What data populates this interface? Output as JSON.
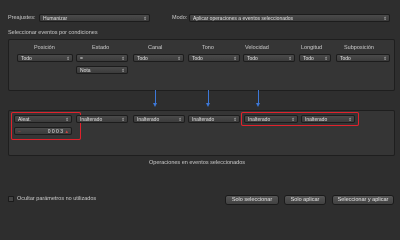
{
  "header": {
    "preset_label": "Preajustes:",
    "preset_value": "Humanizar",
    "mode_label": "Modo:",
    "mode_value": "Aplicar operaciones a eventos seleccionados"
  },
  "conditions": {
    "title": "Seleccionar eventos por condiciones",
    "columns": [
      {
        "label": "Posición",
        "value": "Todo"
      },
      {
        "label": "Estado",
        "value": "="
      },
      {
        "label": "Canal",
        "value": "Todo"
      },
      {
        "label": "Tono",
        "value": "Todo"
      },
      {
        "label": "Velocidad",
        "value": "Todo"
      },
      {
        "label": "Longitud",
        "value": "Todo"
      },
      {
        "label": "Subposición",
        "value": "Todo"
      }
    ],
    "estado_sub": "Nota"
  },
  "operations": {
    "items": [
      {
        "value": "Aleat."
      },
      {
        "value": "Inalterado"
      },
      {
        "value": "Inalterado"
      },
      {
        "value": "Inalterado"
      },
      {
        "value": "Inalterado"
      },
      {
        "value": "Inalterado"
      }
    ],
    "position_value": "0 0 0   3",
    "title": "Operaciones en eventos seleccionados"
  },
  "footer": {
    "hide_unused_label": "Ocultar parámetros no utilizados",
    "buttons": {
      "select_only": "Solo seleccionar",
      "apply_only": "Solo aplicar",
      "select_apply": "Seleccionar y aplicar"
    }
  },
  "colors": {
    "highlight": "#e0222c",
    "arrow": "#3d78d8"
  }
}
